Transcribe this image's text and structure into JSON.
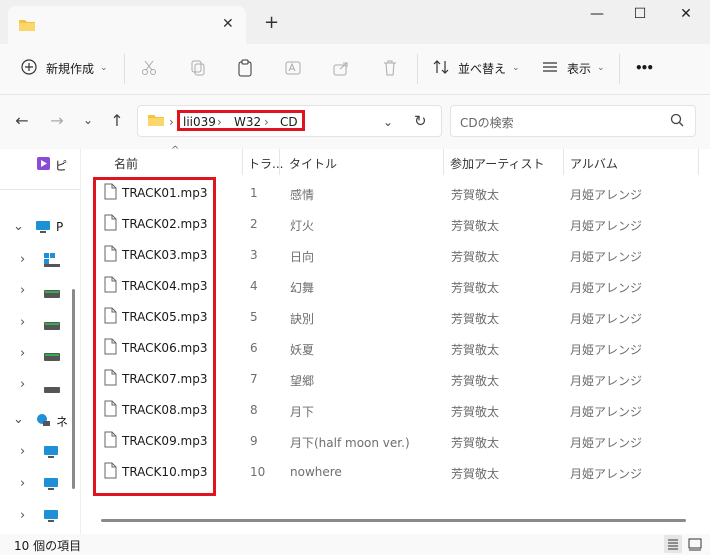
{
  "window": {
    "tab_title": "",
    "tab_close": "✕",
    "new_tab": "+",
    "minimize": "—",
    "maximize": "☐",
    "close": "✕"
  },
  "toolbar": {
    "new_label": "新規作成",
    "sort_label": "並べ替え",
    "view_label": "表示",
    "more_label": "•••"
  },
  "address": {
    "crumbs": [
      "lii039",
      "W32",
      "CD"
    ],
    "separator": "›",
    "search_placeholder": "CDの検索"
  },
  "sidebar": {
    "items": [
      {
        "label": "ピ",
        "chevron": ""
      },
      {
        "label": "P",
        "chevron": "⌄"
      },
      {
        "label": "",
        "chevron": "›"
      },
      {
        "label": "",
        "chevron": "›"
      },
      {
        "label": "",
        "chevron": "›"
      },
      {
        "label": "",
        "chevron": "›"
      },
      {
        "label": "",
        "chevron": "›"
      },
      {
        "label": "ネ",
        "chevron": "⌄"
      },
      {
        "label": "",
        "chevron": "›"
      },
      {
        "label": "",
        "chevron": "›"
      },
      {
        "label": "",
        "chevron": "›"
      }
    ]
  },
  "table": {
    "sort_arrow": "^",
    "columns": [
      "名前",
      "トラ...",
      "タイトル",
      "参加アーティスト",
      "アルバム"
    ],
    "rows": [
      {
        "name": "TRACK01.mp3",
        "track": "1",
        "title": "感情",
        "artist": "芳賀敬太",
        "album": "月姫アレンジ"
      },
      {
        "name": "TRACK02.mp3",
        "track": "2",
        "title": "灯火",
        "artist": "芳賀敬太",
        "album": "月姫アレンジ"
      },
      {
        "name": "TRACK03.mp3",
        "track": "3",
        "title": "日向",
        "artist": "芳賀敬太",
        "album": "月姫アレンジ"
      },
      {
        "name": "TRACK04.mp3",
        "track": "4",
        "title": "幻舞",
        "artist": "芳賀敬太",
        "album": "月姫アレンジ"
      },
      {
        "name": "TRACK05.mp3",
        "track": "5",
        "title": "訣別",
        "artist": "芳賀敬太",
        "album": "月姫アレンジ"
      },
      {
        "name": "TRACK06.mp3",
        "track": "6",
        "title": "妖夏",
        "artist": "芳賀敬太",
        "album": "月姫アレンジ"
      },
      {
        "name": "TRACK07.mp3",
        "track": "7",
        "title": "望郷",
        "artist": "芳賀敬太",
        "album": "月姫アレンジ"
      },
      {
        "name": "TRACK08.mp3",
        "track": "8",
        "title": "月下",
        "artist": "芳賀敬太",
        "album": "月姫アレンジ"
      },
      {
        "name": "TRACK09.mp3",
        "track": "9",
        "title": "月下(half moon ver.)",
        "artist": "芳賀敬太",
        "album": "月姫アレンジ"
      },
      {
        "name": "TRACK10.mp3",
        "track": "10",
        "title": "nowhere",
        "artist": "芳賀敬太",
        "album": "月姫アレンジ"
      }
    ]
  },
  "status": {
    "count_text": "10 個の項目"
  },
  "colors": {
    "highlight": "#e0141e",
    "folder": "#f5c342"
  }
}
